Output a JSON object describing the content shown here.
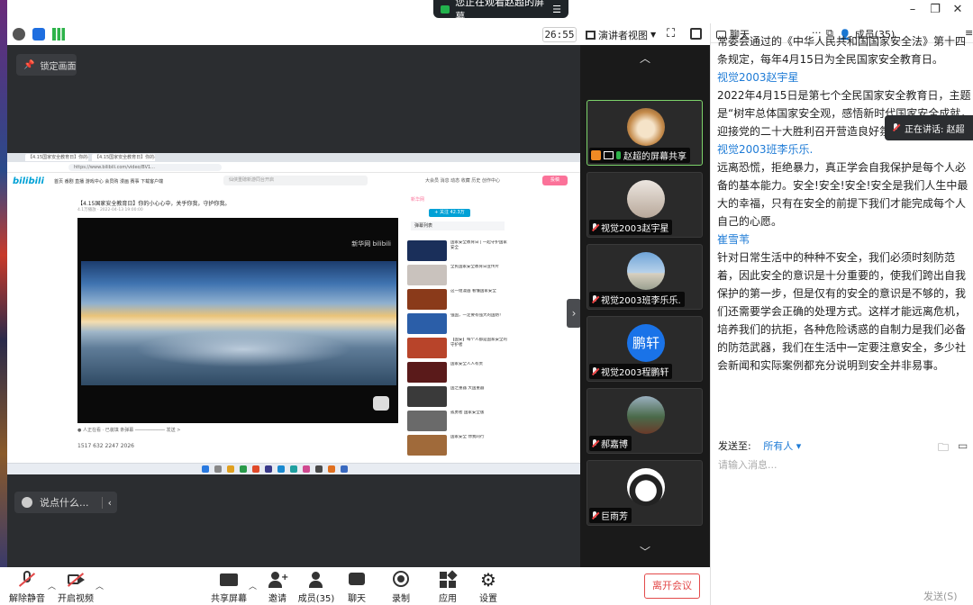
{
  "window": {
    "share_banner": "您正在观看赵超的屏幕",
    "timer": "26:55",
    "view_mode": "演讲者视图"
  },
  "stage": {
    "lock_label": "锁定画面",
    "chat_placeholder": "说点什么...",
    "collapse_icon": "chevron-right"
  },
  "shared_screen": {
    "tabs": [
      "【4.15国家安全教育日】你的小...",
      "【4.15国家安全教育日】你的小..."
    ],
    "url": "https://www.bilibili.com/video/BV1...",
    "logo": "bilibili",
    "nav": "首页 番剧 直播 游戏中心 会员购 漫画 赛事 下载客户端",
    "search_placeholder": "仙侠重磅新游同台开启",
    "upload_label": "投稿",
    "right_links": "大会员 消息 动态 收藏 历史 创作中心",
    "video_title": "【4.15国家安全教育日】你的小心心中，关乎你我，守护你我。",
    "video_meta": "4.1万播放 · 2022-04-13 19:00:00",
    "watermark": "新华网 bilibili",
    "up_name": "新华网",
    "follow_label": "+ 关注 42.3万",
    "rec_head": "弹幕列表",
    "actions": "1517   632   2247   2026",
    "recommend": [
      "国家安全教育日 | 一起守护国家安全",
      "全民国家安全教育日宣传片",
      "这一组漫画 看懂国家安全",
      "强国，一定要有强大的国防！",
      "【国安】每个人都是国家安全的守护者",
      "国家安全人人有责",
      "国之重器 大国重器",
      "孤勇者 国家安全版",
      "国家安全 你我同行"
    ]
  },
  "participants": [
    {
      "name": "赵超的屏幕共享",
      "avatar": "dog-photo",
      "initials": ""
    },
    {
      "name": "视觉2003赵宇星",
      "avatar": "girl-photo",
      "initials": ""
    },
    {
      "name": "视觉2003班李乐乐.",
      "avatar": "sky-photo",
      "initials": ""
    },
    {
      "name": "视觉2003程鹏轩",
      "avatar": "initials",
      "initials": "鹏轩"
    },
    {
      "name": "郝嘉博",
      "avatar": "landscape-photo",
      "initials": ""
    },
    {
      "name": "巨雨芳",
      "avatar": "anime-sketch",
      "initials": ""
    }
  ],
  "chat": {
    "tab_chat": "聊天",
    "tab_members": "成员(35)",
    "messages": [
      {
        "sender": "",
        "text": "常委会通过的《中华人民共和国国家安全法》第十四条规定，每年4月15日为全民国家安全教育日。"
      },
      {
        "sender": "视觉2003赵宇星",
        "text": "2022年4月15日是第七个全民国家安全教育日，主题是“树牢总体国家安全观，感悟新时代国家安全成就，迎接党的二十大胜利召开营造良好氛围”。"
      },
      {
        "sender": "视觉2003班李乐乐.",
        "text": "远离恐慌，拒绝暴力，真正学会自我保护是每个人必备的基本能力。安全!安全!安全!安全是我们人生中最大的幸福，只有在安全的前提下我们才能完成每个人自己的心愿。"
      },
      {
        "sender": "崔雪苇",
        "text": "针对日常生活中的种种不安全，我们必须时刻防范着，因此安全的意识是十分重要的，使我们跨出自我保护的第一步，但是仅有的安全的意识是不够的，我们还需要学会正确的处理方式。这样才能远离危机，培养我们的抗拒，各种危险诱惑的自制力是我们必备的防范武器，我们在生活中一定要注意安全，多少社会新闻和实际案例都充分说明到安全并非易事。"
      }
    ],
    "speaking_label": "正在讲话: 赵超",
    "send_to_label": "发送至:",
    "send_to_value": "所有人 ▾",
    "input_placeholder": "请输入消息...",
    "send_button": "发送(S)"
  },
  "controls": {
    "unmute": "解除静音",
    "start_video": "开启视频",
    "share_screen": "共享屏幕",
    "invite": "邀请",
    "members": "成员(35)",
    "chat": "聊天",
    "record": "录制",
    "apps": "应用",
    "settings": "设置",
    "leave": "离开会议"
  },
  "colors": {
    "accent": "#1e7bd6",
    "leave": "#e34a4a",
    "active_border": "#7cd36a",
    "stage_bg": "#2b2d30"
  }
}
